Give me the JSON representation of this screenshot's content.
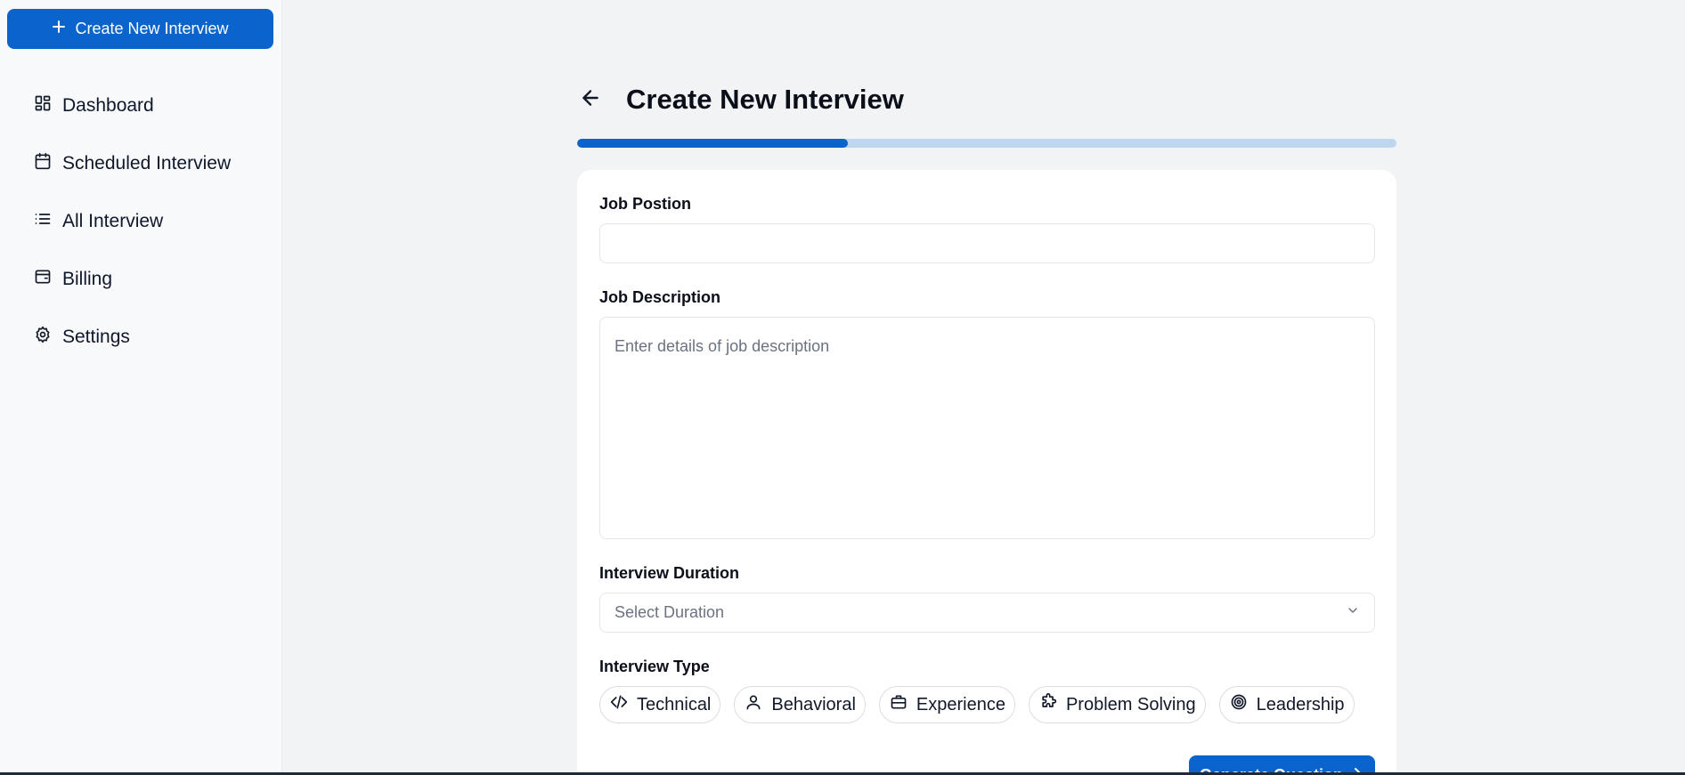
{
  "sidebar": {
    "create_button_label": "Create New Interview",
    "items": [
      {
        "label": "Dashboard",
        "icon": "layout-dashboard-icon"
      },
      {
        "label": "Scheduled Interview",
        "icon": "calendar-icon"
      },
      {
        "label": "All Interview",
        "icon": "list-icon"
      },
      {
        "label": "Billing",
        "icon": "wallet-icon"
      },
      {
        "label": "Settings",
        "icon": "settings-icon"
      }
    ]
  },
  "header": {
    "title": "Create New Interview"
  },
  "progress": {
    "value_percent": 33,
    "colors": {
      "fill": "#0a64cc",
      "track": "#bfd6ef"
    }
  },
  "form": {
    "job_position": {
      "label": "Job Postion",
      "value": "",
      "placeholder": ""
    },
    "job_description": {
      "label": "Job Description",
      "value": "",
      "placeholder": "Enter details of job description"
    },
    "interview_duration": {
      "label": "Interview Duration",
      "selected": "Select Duration"
    },
    "interview_type": {
      "label": "Interview Type",
      "options": [
        {
          "label": "Technical",
          "icon": "code-icon"
        },
        {
          "label": "Behavioral",
          "icon": "user-icon"
        },
        {
          "label": "Experience",
          "icon": "briefcase-icon"
        },
        {
          "label": "Problem Solving",
          "icon": "puzzle-icon"
        },
        {
          "label": "Leadership",
          "icon": "target-icon"
        }
      ]
    },
    "generate_button_label": "Generate Question"
  },
  "theme": {
    "accent": "#0a64cc",
    "background": "#f2f3f5",
    "sidebar_background": "#f7f9fb"
  }
}
